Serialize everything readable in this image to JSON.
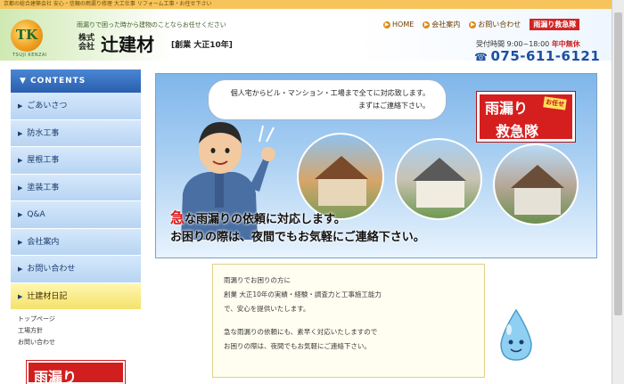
{
  "top_strip": {
    "text": "京都の総合建築会社 安心・信頼の雨漏り修理 大工仕事 リフォーム工事・お任せ下さい"
  },
  "header": {
    "logo_letters": "TK",
    "logo_sub": "TSUJI KENZAI",
    "tagline": "雨漏りで困った時から建物のことならお任せください",
    "company_prefix": "株式会社",
    "company_name": "辻建材",
    "founded": "[創業 大正10年]",
    "nav": [
      {
        "icon": "home-icon",
        "label": "HOME"
      },
      {
        "icon": "company-icon",
        "label": "会社案内"
      },
      {
        "icon": "mail-icon",
        "label": "お問い合わせ"
      }
    ],
    "emergency_label": "雨漏り救急隊",
    "hours_label": "受付時間 9:00~18:00",
    "hours_note": "年中無休",
    "phone": "075-611-6121",
    "phone_icon": "phone-icon"
  },
  "sidebar": {
    "heading": "CONTENTS",
    "items": [
      {
        "label": "ごあいさつ",
        "active": false
      },
      {
        "label": "防水工事",
        "active": false
      },
      {
        "label": "屋根工事",
        "active": false
      },
      {
        "label": "塗装工事",
        "active": false
      },
      {
        "label": "Q&A",
        "active": false
      },
      {
        "label": "会社案内",
        "active": false
      },
      {
        "label": "お問い合わせ",
        "active": false
      },
      {
        "label": "辻建材日記",
        "active": true
      }
    ],
    "sublinks": [
      "トップページ",
      "工場方針",
      "お問い合わせ"
    ],
    "banner_label": "雨漏り"
  },
  "hero": {
    "speech_line1": "個人宅からビル・マンション・工場まで全てに対応致します。",
    "speech_line2": "まずはご連絡下さい。",
    "badge_line1": "雨漏り",
    "badge_line2": "救急隊",
    "badge_tag": "お任せ",
    "headline_accent": "急",
    "headline_line1": "な雨漏りの依頼に対応します。",
    "headline_line2": "お困りの際は、夜間でもお気軽にご連絡下さい。"
  },
  "info": {
    "lines": [
      "雨漏りでお困りの方に",
      "創業 大正10年の実績・経験・調査力と工事施工能力",
      "で、安心を提供いたします。",
      "",
      "急な雨漏りの依頼にも、素早く対応いたしますので",
      "お困りの際は、夜間でもお気軽にご連絡下さい。"
    ]
  },
  "colors": {
    "nav_blue": "#2a5fae",
    "accent_red": "#d51f1f",
    "phone_blue": "#1c4f9c",
    "top_strip": "#f6c45a"
  }
}
